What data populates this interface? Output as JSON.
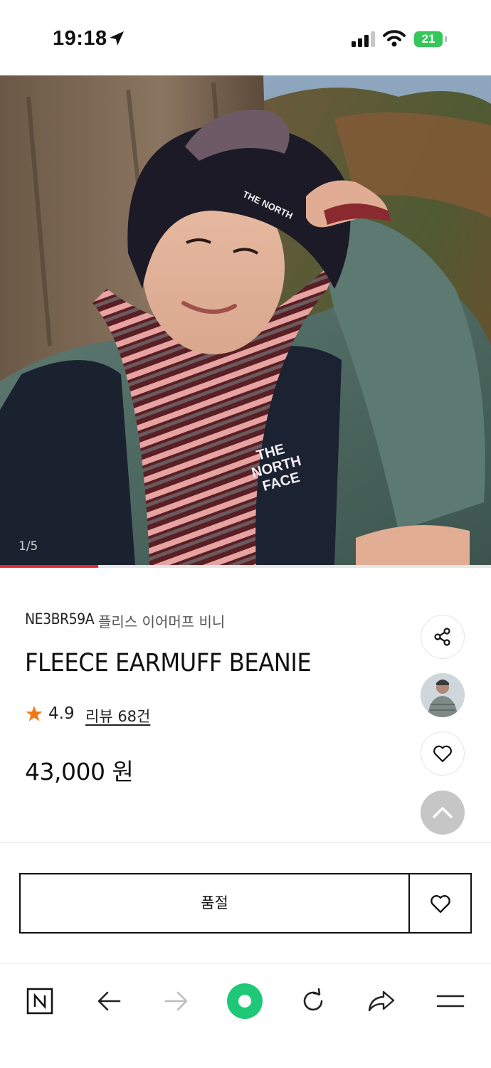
{
  "status": {
    "time": "19:18",
    "battery": "21"
  },
  "hero": {
    "counter": "1/5",
    "progress": 0.2,
    "brand_text": "THE NORTH FACE"
  },
  "product": {
    "code": "NE3BR59A",
    "korean_name": "플리스 이어머프 비니",
    "title": "FLEECE EARMUFF BEANIE",
    "rating": "4.9",
    "reviews_label": "리뷰 68건",
    "price": "43,000 원"
  },
  "actions": {
    "soldout_label": "품절"
  },
  "icons": {
    "share": "share-icon",
    "like": "heart-icon",
    "top": "chevron-up-icon",
    "browser": [
      "naver-n-icon",
      "back-arrow-icon",
      "forward-arrow-icon",
      "green-dot-icon",
      "refresh-icon",
      "share-arrow-icon",
      "menu-icon"
    ]
  },
  "colors": {
    "accent": "#e2263a",
    "star": "#f07a1a",
    "green": "#1ec800",
    "battery": "#34c759"
  }
}
